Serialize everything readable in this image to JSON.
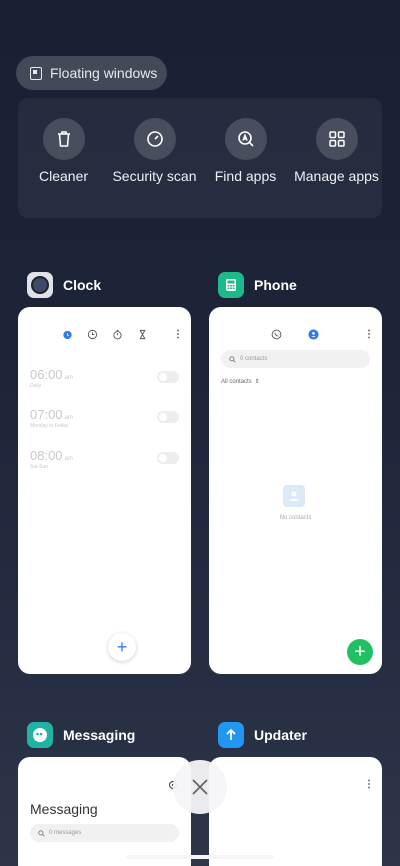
{
  "floating_windows": {
    "label": "Floating windows"
  },
  "quick_actions": [
    {
      "label": "Cleaner",
      "icon": "trash-icon"
    },
    {
      "label": "Security scan",
      "icon": "security-gauge-icon"
    },
    {
      "label": "Find apps",
      "icon": "find-apps-icon"
    },
    {
      "label": "Manage apps",
      "icon": "grid-icon"
    }
  ],
  "apps": {
    "clock": {
      "name": "Clock",
      "alarms": [
        {
          "time": "06:00",
          "ampm": "am",
          "repeat": "Daily"
        },
        {
          "time": "07:00",
          "ampm": "am",
          "repeat": "Monday to Friday"
        },
        {
          "time": "08:00",
          "ampm": "am",
          "repeat": "Sat-Sun"
        }
      ]
    },
    "phone": {
      "name": "Phone",
      "search_placeholder": "0 contacts",
      "filter": "All contacts",
      "empty": "No contacts"
    },
    "messaging": {
      "name": "Messaging",
      "title": "Messaging",
      "search_placeholder": "0 messages"
    },
    "updater": {
      "name": "Updater"
    }
  },
  "colors": {
    "accent_blue": "#2d7be6",
    "phone_icon_green": "#1db98b",
    "messaging_icon_teal": "#21b3a3",
    "updater_icon_blue": "#2196f3",
    "fab_green": "#22c064"
  }
}
